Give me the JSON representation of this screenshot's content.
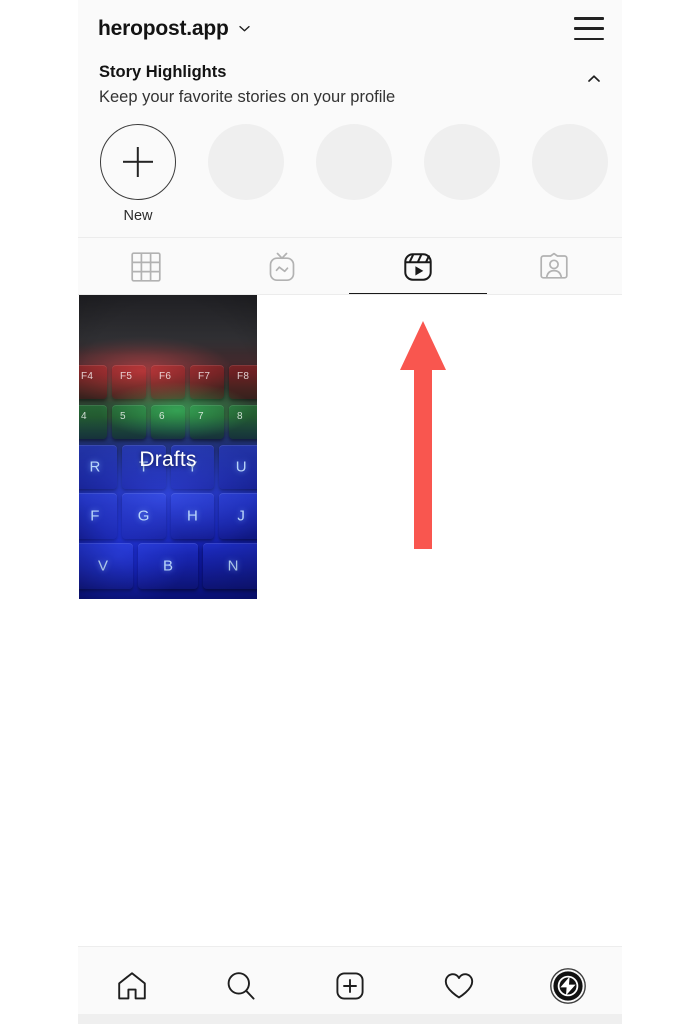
{
  "window": {
    "background": "#ffffff",
    "phone_background": "#fafafa"
  },
  "topbar": {
    "username": "heropost.app",
    "dropdown_icon": "chevron-down-icon",
    "menu_icon": "hamburger-menu-icon"
  },
  "highlights": {
    "title": "Story Highlights",
    "subtitle": "Keep your favorite stories on your profile",
    "collapse_icon": "chevron-up-icon",
    "items": [
      {
        "label": "New",
        "type": "new",
        "icon": "plus-icon"
      },
      {
        "label": "",
        "type": "placeholder",
        "icon": ""
      },
      {
        "label": "",
        "type": "placeholder",
        "icon": ""
      },
      {
        "label": "",
        "type": "placeholder",
        "icon": ""
      },
      {
        "label": "",
        "type": "placeholder",
        "icon": ""
      }
    ],
    "placeholder_color": "#efefef"
  },
  "profile_tabs": {
    "active_index": 2,
    "underline_color": "#191919",
    "items": [
      {
        "name": "grid-tab",
        "icon": "grid-icon",
        "active": false
      },
      {
        "name": "igtv-tab",
        "icon": "igtv-icon",
        "active": false
      },
      {
        "name": "reels-tab",
        "icon": "reels-icon",
        "active": true
      },
      {
        "name": "tagged-tab",
        "icon": "tagged-person-icon",
        "active": false
      }
    ]
  },
  "reels_grid": {
    "items": [
      {
        "label": "Drafts",
        "thumbnail_description": "RGB backlit mechanical keyboard",
        "keys": {
          "function_row": [
            "F4",
            "F5",
            "F6",
            "F7",
            "F8"
          ],
          "number_row": [
            "4",
            "5",
            "6",
            "7",
            "8"
          ],
          "letter_row": [
            "R",
            "T",
            "Y",
            "U"
          ],
          "home_row": [
            "F",
            "G",
            "H",
            "J"
          ],
          "bottom_row": [
            "V",
            "B",
            "N"
          ]
        }
      }
    ]
  },
  "annotation": {
    "type": "arrow",
    "direction": "up",
    "color": "#F9564F",
    "points_to": "reels-tab"
  },
  "bottom_nav": {
    "items": [
      {
        "name": "home-nav-button",
        "icon": "home-icon"
      },
      {
        "name": "search-nav-button",
        "icon": "search-icon"
      },
      {
        "name": "create-nav-button",
        "icon": "plus-square-icon"
      },
      {
        "name": "activity-nav-button",
        "icon": "heart-icon"
      },
      {
        "name": "profile-nav-button",
        "icon": "profile-avatar-icon"
      }
    ]
  }
}
